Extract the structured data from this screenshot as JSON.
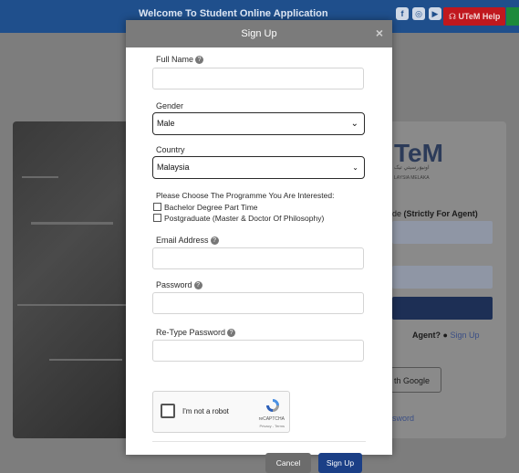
{
  "background": {
    "welcome_text": "Welcome To Student Online Application",
    "social_icons": [
      "facebook-icon",
      "instagram-icon",
      "youtube-icon",
      "twitter-icon",
      "linkedin-icon",
      "telegram-icon"
    ],
    "help_label": "UTeM Help",
    "logo_text": "TeM",
    "logo_sub": "اونيۏرسيتي تيک",
    "logo_sub2": "LAYSIA MELAKA",
    "agent_code_prefix": "de",
    "agent_code_bold": "(Strictly For Agent)",
    "agent_question": "Agent?",
    "agent_signup": "Sign Up",
    "google_label": "th Google",
    "forgot_label": "sword"
  },
  "modal": {
    "title": "Sign Up",
    "close_symbol": "×",
    "full_name_label": "Full Name",
    "gender_label": "Gender",
    "gender_value": "Male",
    "country_label": "Country",
    "country_value": "Malaysia",
    "programme_label": "Please Choose The Programme You Are Interested:",
    "programme_options": [
      "Bachelor Degree Part Time",
      "Postgraduate (Master & Doctor Of Philosophy)"
    ],
    "email_label": "Email Address",
    "password_label": "Password",
    "retype_label": "Re-Type Password",
    "recaptcha_text": "I'm not a robot",
    "recaptcha_brand": "reCAPTCHA",
    "recaptcha_terms": "Privacy - Terms",
    "cancel_label": "Cancel",
    "signup_label": "Sign Up"
  },
  "colors": {
    "primary": "#1b3f86",
    "cancel": "#6c6c6c",
    "header": "#7b7b7b",
    "help": "#c0181e"
  }
}
